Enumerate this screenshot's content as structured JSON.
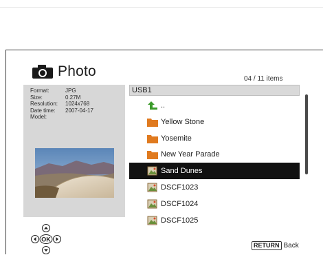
{
  "header": {
    "title": "Photo",
    "items_count": "04 / 11 items"
  },
  "info": {
    "rows": [
      {
        "key": "Format:",
        "value": "JPG"
      },
      {
        "key": "Size:",
        "value": "0.27M"
      },
      {
        "key": "Resolution:",
        "value": "1024x768"
      },
      {
        "key": "Date time:",
        "value": "2007-04-17"
      },
      {
        "key": "Model:",
        "value": ""
      }
    ]
  },
  "path": "USB1",
  "list": [
    {
      "label": "..",
      "icon": "up-arrow-icon"
    },
    {
      "label": "Yellow Stone",
      "icon": "folder-icon"
    },
    {
      "label": "Yosemite",
      "icon": "folder-icon"
    },
    {
      "label": "New Year Parade",
      "icon": "folder-icon"
    },
    {
      "label": "Sand Dunes",
      "icon": "photo-file-icon",
      "selected": true
    },
    {
      "label": "DSCF1023",
      "icon": "photo-file-icon"
    },
    {
      "label": "DSCF1024",
      "icon": "photo-file-icon"
    },
    {
      "label": "DSCF1025",
      "icon": "photo-file-icon"
    }
  ],
  "nav": {
    "ok_label": "OK"
  },
  "footer": {
    "return_key": "RETURN",
    "return_label": "Back"
  },
  "colors": {
    "selection": "#111111",
    "panel": "#d7d7d7",
    "folder": "#e07a1f",
    "up_arrow": "#3a9a2a"
  }
}
